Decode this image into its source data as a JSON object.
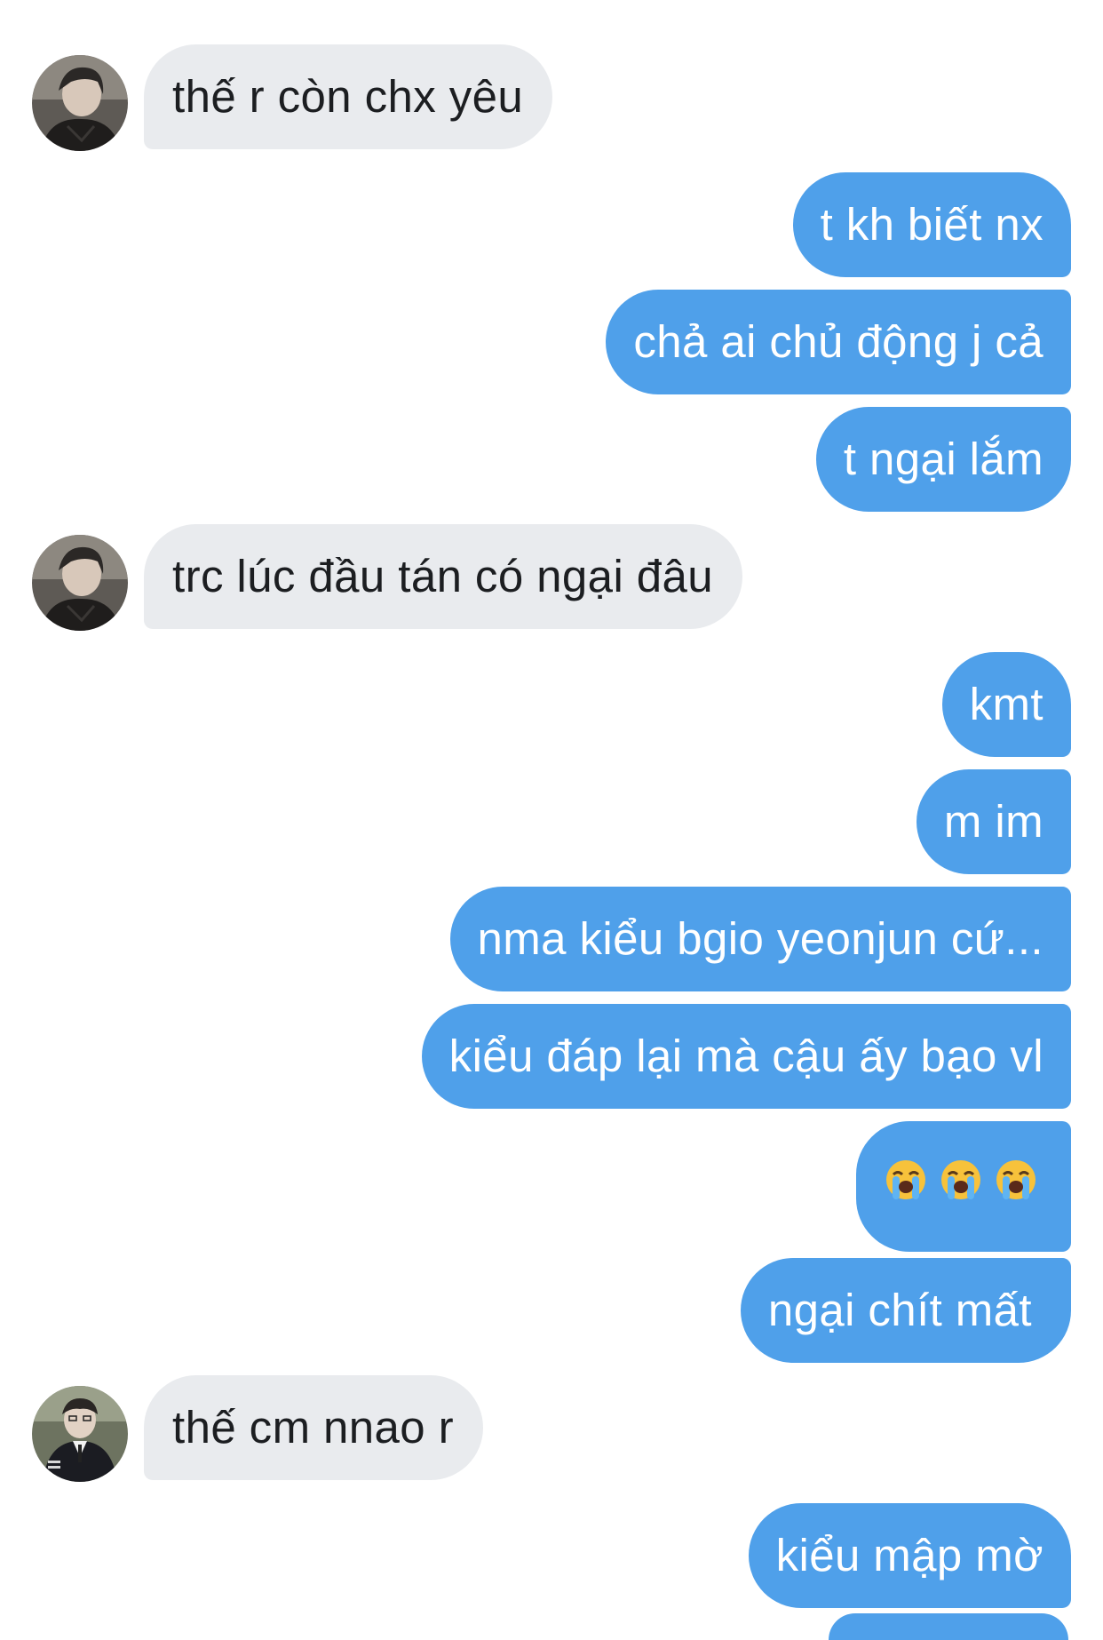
{
  "colors": {
    "incoming_bubble": "#e9ebee",
    "outgoing_bubble": "#4fa0ea",
    "outgoing_text": "#ffffff",
    "incoming_text": "#1c1e21"
  },
  "messages": [
    {
      "side": "incoming",
      "avatar": "avatar-dark-jacket",
      "text": "thế r còn chx yêu"
    },
    {
      "side": "outgoing",
      "text": "t kh biết nx"
    },
    {
      "side": "outgoing",
      "text": "chả ai chủ động j cả"
    },
    {
      "side": "outgoing",
      "text": "t ngại lắm"
    },
    {
      "side": "incoming",
      "avatar": "avatar-dark-jacket",
      "text": "trc lúc đầu tán có ngại đâu"
    },
    {
      "side": "outgoing",
      "text": "kmt"
    },
    {
      "side": "outgoing",
      "text": "m im"
    },
    {
      "side": "outgoing",
      "text": "nma kiểu bgio yeonjun cứ..."
    },
    {
      "side": "outgoing",
      "text": "kiểu đáp lại mà cậu ấy bạo vl"
    },
    {
      "side": "outgoing",
      "emoji": [
        "loudly-crying-face-icon",
        "loudly-crying-face-icon",
        "loudly-crying-face-icon"
      ]
    },
    {
      "side": "outgoing",
      "text": "ngại chít mất"
    },
    {
      "side": "incoming",
      "avatar": "avatar-suit",
      "text": "thế cm nnao r"
    },
    {
      "side": "outgoing",
      "text": "kiểu mập mờ"
    }
  ]
}
